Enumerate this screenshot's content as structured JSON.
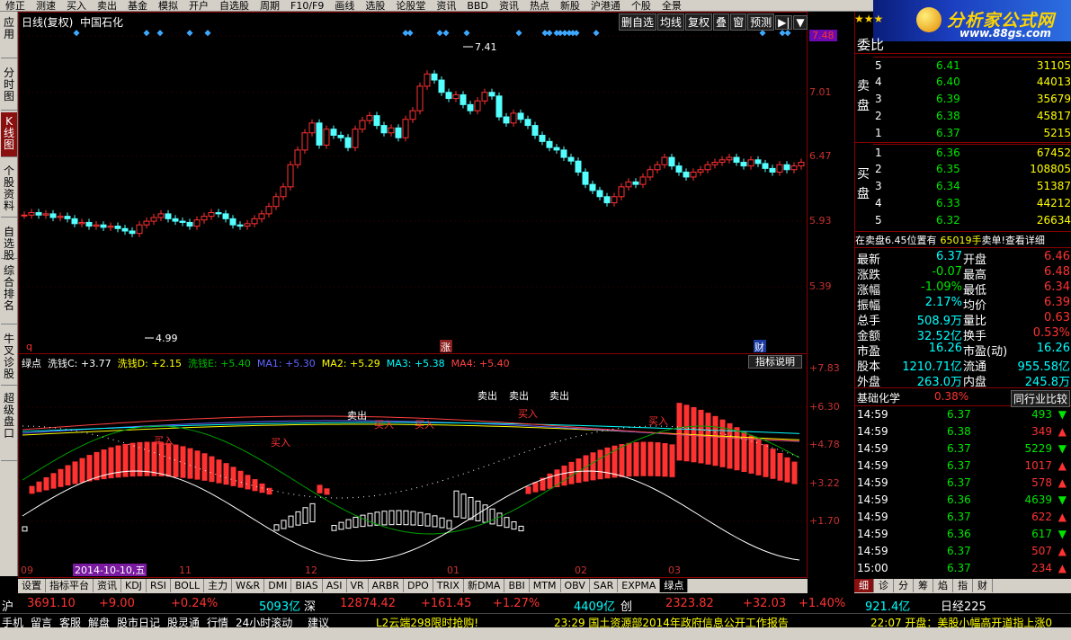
{
  "menu": [
    "修正",
    "测速",
    "买入",
    "卖出",
    "基金",
    "模拟",
    "开户",
    "自选股",
    "周期",
    "F10/F9",
    "画线",
    "选股",
    "论股堂",
    "资讯",
    "BBD",
    "资讯",
    "热点",
    "新股",
    "沪港通",
    "个股",
    "全景"
  ],
  "logo": {
    "name": "分析家公式网",
    "url": "www.88gs.com",
    "stars": "★★★"
  },
  "sidebar": [
    "应用",
    "分时图",
    "K线图",
    "个股资料",
    "自选股",
    "综合排名",
    "牛叉诊股",
    "超级盘口"
  ],
  "chart_header": {
    "period": "日线(复权)",
    "name": "中国石化"
  },
  "chart_buttons": [
    "删自选",
    "均线",
    "复权",
    "叠",
    "窗",
    "预测",
    "▶|",
    "▼"
  ],
  "price_axis": [
    "7.48",
    "7.01",
    "6.47",
    "5.93",
    "5.39"
  ],
  "indicator_axis": [
    "+7.83",
    "+6.30",
    "+4.78",
    "+3.22",
    "+1.70"
  ],
  "marks": {
    "high": "7.41",
    "low": "4.99",
    "left": "q",
    "mid": "涨",
    "right": "财"
  },
  "indicator_header": [
    {
      "t": "绿点",
      "c": "#ffffff"
    },
    {
      "t": "洗钱C: +3.77",
      "c": "#ffffff"
    },
    {
      "t": "洗钱D: +2.15",
      "c": "#ffff00"
    },
    {
      "t": "洗钱E: +5.40",
      "c": "#00c000"
    },
    {
      "t": "MA1: +5.30",
      "c": "#6464ff"
    },
    {
      "t": "MA2: +5.29",
      "c": "#ffff00"
    },
    {
      "t": "MA3: +5.38",
      "c": "#00ffff"
    },
    {
      "t": "MA4: +5.40",
      "c": "#ff4040"
    }
  ],
  "help_label": "指标说明",
  "dates": [
    "09",
    "2014-10-10,五",
    "11",
    "12",
    "01",
    "02",
    "03"
  ],
  "signals": {
    "buy": "买入",
    "sell": "卖出"
  },
  "ask": [
    [
      "5",
      "6.41",
      "31105"
    ],
    [
      "4",
      "6.40",
      "44013"
    ],
    [
      "3",
      "6.39",
      "35679"
    ],
    [
      "2",
      "6.38",
      "45817"
    ],
    [
      "1",
      "6.37",
      "5215"
    ]
  ],
  "bid": [
    [
      "1",
      "6.36",
      "67452"
    ],
    [
      "2",
      "6.35",
      "108805"
    ],
    [
      "3",
      "6.34",
      "51387"
    ],
    [
      "4",
      "6.33",
      "44212"
    ],
    [
      "5",
      "6.32",
      "26634"
    ]
  ],
  "ratio_label": "委比",
  "sell_label": "卖盘",
  "buy_label": "买盘",
  "note": {
    "a": "在卖盘6.45位置有",
    "b": "65019手",
    "c": "卖单!",
    "d": "查看详细"
  },
  "stats": [
    [
      "最新",
      "6.37",
      "开盘",
      "6.46"
    ],
    [
      "涨跌",
      "-0.07",
      "最高",
      "6.48"
    ],
    [
      "涨幅",
      "-1.09%",
      "最低",
      "6.34"
    ],
    [
      "振幅",
      "2.17%",
      "均价",
      "6.39"
    ],
    [
      "总手",
      "508.9万",
      "量比",
      "0.63"
    ],
    [
      "金额",
      "32.52亿",
      "换手",
      "0.53%"
    ],
    [
      "市盈",
      "16.26",
      "市盈(动)",
      "16.26"
    ],
    [
      "股本",
      "1210.71亿",
      "流通",
      "955.58亿"
    ],
    [
      "外盘",
      "263.0万",
      "内盘",
      "245.8万"
    ]
  ],
  "sector": {
    "name": "基础化学",
    "pct": "0.38%",
    "btn": "同行业比较"
  },
  "ticks": [
    [
      "14:59",
      "6.37",
      "493",
      "dn"
    ],
    [
      "14:59",
      "6.38",
      "349",
      "up"
    ],
    [
      "14:59",
      "6.37",
      "5229",
      "dn"
    ],
    [
      "14:59",
      "6.37",
      "1017",
      "up"
    ],
    [
      "14:59",
      "6.37",
      "578",
      "up"
    ],
    [
      "14:59",
      "6.36",
      "4639",
      "dn"
    ],
    [
      "14:59",
      "6.37",
      "622",
      "up"
    ],
    [
      "14:59",
      "6.36",
      "617",
      "dn"
    ],
    [
      "14:59",
      "6.37",
      "507",
      "up"
    ],
    [
      "15:00",
      "6.37",
      "234",
      "up"
    ]
  ],
  "tabs": [
    "设置",
    "指标平台",
    "资讯",
    "KDJ",
    "RSI",
    "BOLL",
    "主力",
    "W&R",
    "DMI",
    "BIAS",
    "ASI",
    "VR",
    "ARBR",
    "DPO",
    "TRIX",
    "新DMA",
    "BBI",
    "MTM",
    "OBV",
    "SAR",
    "EXPMA",
    "绿点"
  ],
  "rtabs": [
    "细",
    "诊",
    "分",
    "筹",
    "焰",
    "指",
    "财"
  ],
  "index": {
    "sh": "沪",
    "shv": "3691.10",
    "shc": "+9.00",
    "shp": "+0.24%",
    "sha": "5093亿",
    "sz": "深",
    "szv": "12874.42",
    "szc": "+161.45",
    "szp": "+1.27%",
    "sza": "4409亿",
    "cy": "创",
    "cyv": "2323.82",
    "cyc": "+32.03",
    "cyp": "+1.40%",
    "cya": "921.4亿",
    "rj": "日经225"
  },
  "status": [
    "手机",
    "留言",
    "客服",
    "解盘",
    "股市日记",
    "股灵通",
    "行情",
    "24小时滚动",
    "建议"
  ],
  "news": {
    "a": "L2云端298限时抢购!",
    "b": "23:29 国土资源部2014年政府信息公开工作报告",
    "c": "22:07 开盘：美股小幅高开道指上涨0"
  }
}
